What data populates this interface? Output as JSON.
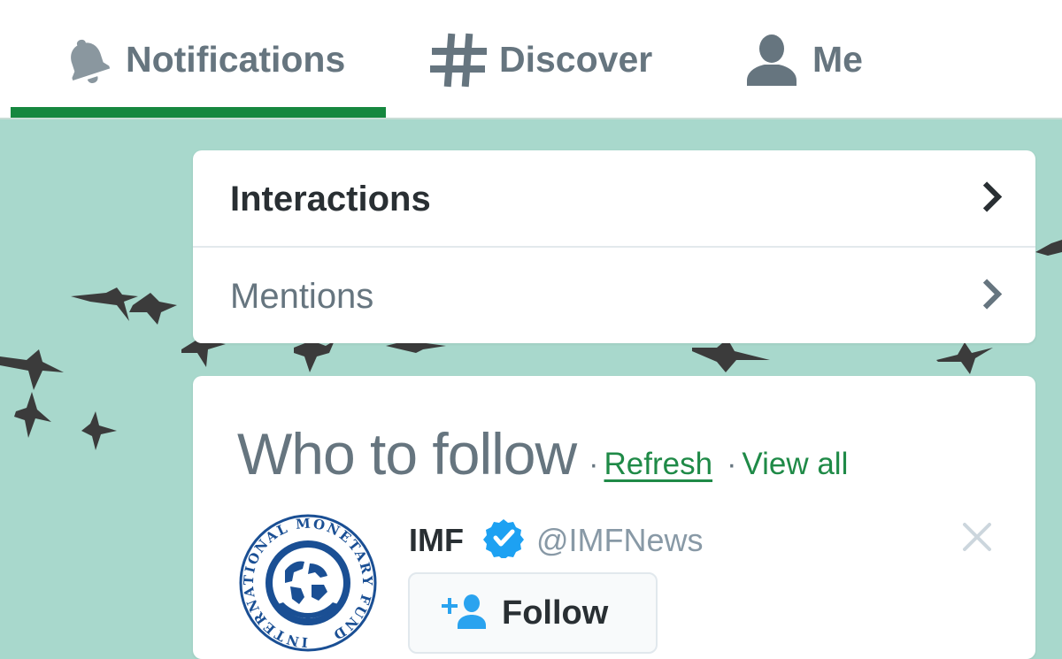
{
  "nav": {
    "tabs": [
      {
        "label": "Notifications",
        "icon": "bell-icon",
        "active": true
      },
      {
        "label": "Discover",
        "icon": "hashtag-icon",
        "active": false
      },
      {
        "label": "Me",
        "icon": "person-icon",
        "active": false
      }
    ]
  },
  "notifications_menu": {
    "items": [
      {
        "label": "Interactions"
      },
      {
        "label": "Mentions"
      }
    ]
  },
  "who_to_follow": {
    "title": "Who to follow",
    "refresh": "Refresh",
    "view_all": "View all",
    "separator": "·",
    "suggestion": {
      "name": "IMF",
      "handle": "@IMFNews",
      "verified": true,
      "follow_label": "Follow",
      "avatar_text": "INTERNATIONAL MONETARY FUND"
    }
  },
  "colors": {
    "accent_green": "#16873f",
    "link_green": "#1f8a47",
    "background_teal": "#a8d8cc",
    "verified_blue": "#1da1f2",
    "imf_blue": "#1a4f94"
  }
}
